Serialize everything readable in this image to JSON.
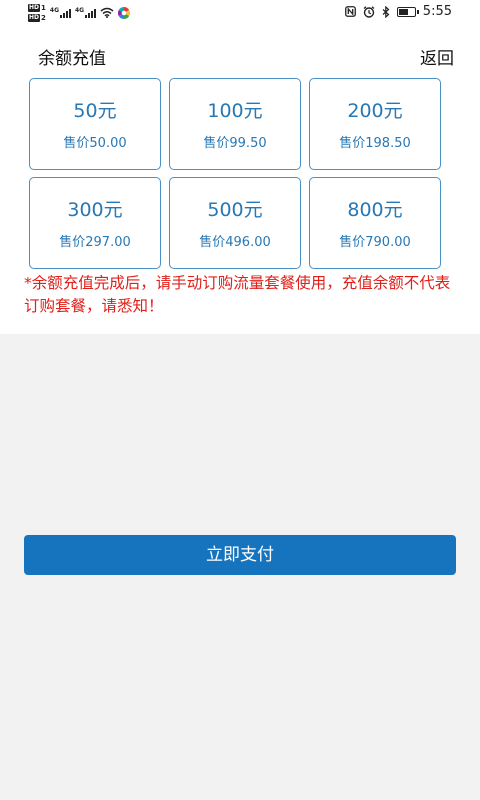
{
  "status_bar": {
    "sim1_badge": "HD",
    "sim1_number": "1",
    "sim2_badge": "HD",
    "sim2_number": "2",
    "network_label_1": "4G",
    "network_label_2": "4G",
    "time": "5:55",
    "battery_level_percent": 70
  },
  "header": {
    "title": "余额充值",
    "back_label": "返回"
  },
  "options": [
    {
      "amount": "50元",
      "price": "售价50.00"
    },
    {
      "amount": "100元",
      "price": "售价99.50"
    },
    {
      "amount": "200元",
      "price": "售价198.50"
    },
    {
      "amount": "300元",
      "price": "售价297.00"
    },
    {
      "amount": "500元",
      "price": "售价496.00"
    },
    {
      "amount": "800元",
      "price": "售价790.00"
    }
  ],
  "notice": "*余额充值完成后，请手动订购流量套餐使用，充值余额不代表订购套餐，请悉知！",
  "pay_button_label": "立即支付",
  "colors": {
    "accent": "#2778b4",
    "card_border": "#4a90c4",
    "pay_button": "#1674be",
    "notice": "#e0201a",
    "page_background": "#f2f2f2"
  }
}
